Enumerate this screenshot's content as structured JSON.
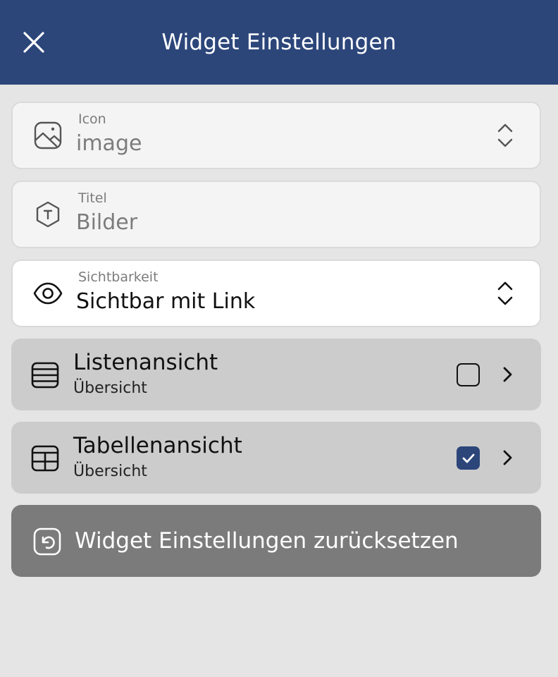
{
  "header": {
    "title": "Widget Einstellungen",
    "close_icon": "close-icon",
    "background_color": "#2c467a"
  },
  "fields": [
    {
      "label": "Icon",
      "value": "image",
      "icon": "image-icon",
      "control": "updown-icon"
    },
    {
      "label": "Titel",
      "value": "Bilder",
      "icon": "title-hexagon-icon"
    },
    {
      "label": "Sichtbarkeit",
      "value": "Sichtbar mit Link",
      "icon": "eye-icon",
      "control": "updown-icon"
    }
  ],
  "views": [
    {
      "title": "Listenansicht",
      "subtitle": "Übersicht",
      "icon": "list-icon",
      "checked": false
    },
    {
      "title": "Tabellenansicht",
      "subtitle": "Übersicht",
      "icon": "table-icon",
      "checked": true
    }
  ],
  "reset": {
    "label": "Widget Einstellungen zurücksetzen",
    "icon": "reset-icon"
  },
  "colors": {
    "accent": "#2c467a",
    "background": "#e5e5e5",
    "row_background": "#cccccc",
    "reset_background": "#7b7b7b"
  }
}
